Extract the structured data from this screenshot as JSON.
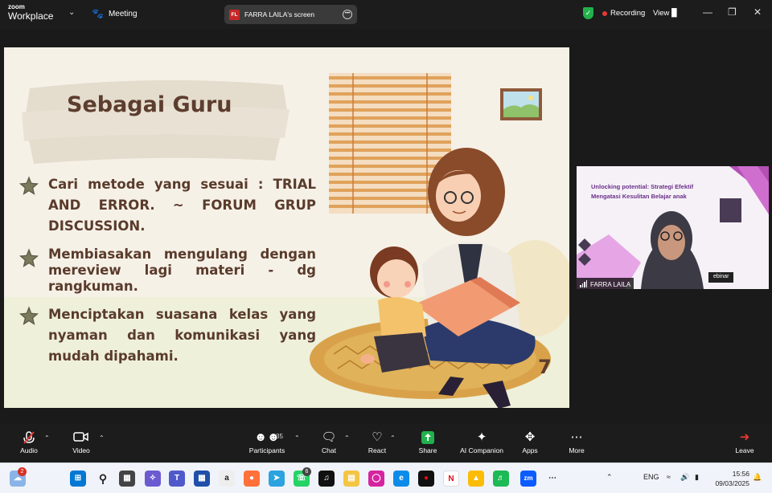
{
  "topbar": {
    "logo_line1": "zoom",
    "logo_line2": "Workplace",
    "meeting_label": "Meeting",
    "screen_share_badge": "FL",
    "screen_share_title": "FARRA LAILA's screen",
    "recording_label": "Recording",
    "view_label": "View"
  },
  "slide": {
    "title": "Sebagai Guru",
    "bullets": [
      "Cari metode yang sesuai : TRIAL AND ERROR. ~ FORUM GRUP DISCUSSION.",
      "Membiasakan mengulang dengan mereview lagi materi - dg rangkuman.",
      "Menciptakan suasana kelas yang nyaman dan komunikasi yang mudah dipahami."
    ],
    "page_number": "7"
  },
  "participant_video": {
    "banner_text": "Unlocking potential: Strategi Efektif Mengatasi Kesulitan Belajar anak",
    "name": "FARRA LAILA",
    "tag": "ebinar"
  },
  "toolbar": {
    "audio": "Audio",
    "video": "Video",
    "participants": "Participants",
    "participants_count": "35",
    "chat": "Chat",
    "react": "React",
    "share": "Share",
    "ai_companion": "AI Companion",
    "apps": "Apps",
    "more": "More",
    "leave": "Leave"
  },
  "taskbar": {
    "weather_badge": "2",
    "whatsapp_badge": "6",
    "language": "ENG",
    "time": "15:56",
    "date": "09/03/2025"
  },
  "colors": {
    "zoom_bg": "#1c1c1c",
    "slide_bg": "#f6f1e7",
    "slide_text": "#5a3b2c",
    "recording_dot": "#e53935",
    "share_green": "#22b14c"
  }
}
